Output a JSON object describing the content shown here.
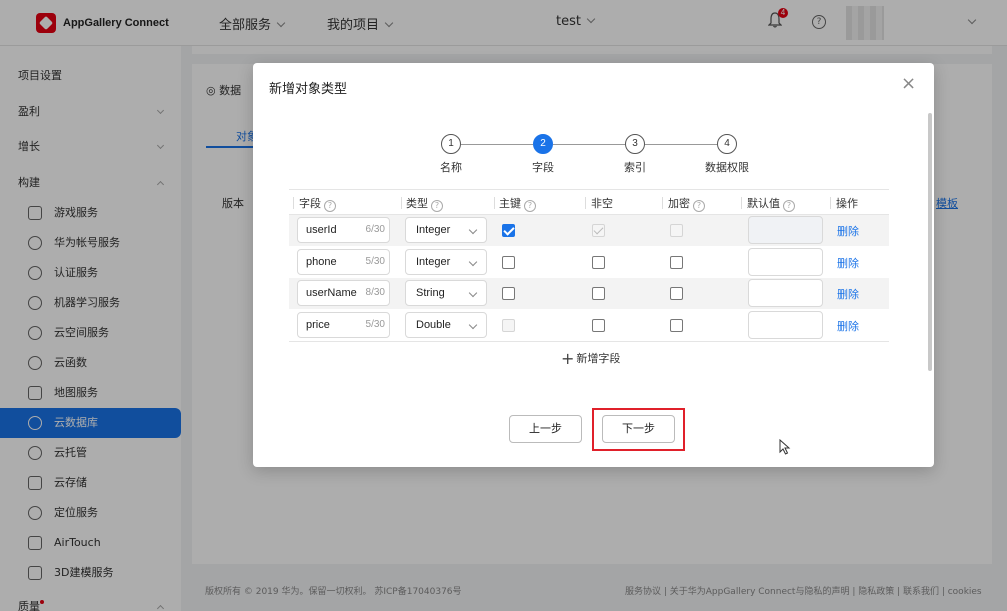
{
  "header": {
    "brand": "AppGallery Connect",
    "nav": [
      "全部服务",
      "我的项目"
    ],
    "project": "test",
    "notification_count": "4",
    "help_icon": "?"
  },
  "sidebar": {
    "items": [
      {
        "label": "项目设置"
      },
      {
        "label": "盈利"
      },
      {
        "label": "增长"
      },
      {
        "label": "构建"
      },
      {
        "label": "游戏服务"
      },
      {
        "label": "华为帐号服务"
      },
      {
        "label": "认证服务"
      },
      {
        "label": "机器学习服务"
      },
      {
        "label": "云空间服务"
      },
      {
        "label": "云函数"
      },
      {
        "label": "地图服务"
      },
      {
        "label": "云数据库"
      },
      {
        "label": "云托管"
      },
      {
        "label": "云存储"
      },
      {
        "label": "定位服务"
      },
      {
        "label": "AirTouch"
      },
      {
        "label": "3D建模服务"
      },
      {
        "label": "质量"
      }
    ]
  },
  "background": {
    "crumb": "数据",
    "tab": "对象",
    "version_label": "版本",
    "template_link": "模板"
  },
  "footer": {
    "copyright": "版权所有 © 2019 华为。保留一切权利。 苏ICP备17040376号",
    "links": "服务协议 | 关于华为AppGallery Connect与隐私的声明 | 隐私政策 | 联系我们 | cookies"
  },
  "modal": {
    "title": "新增对象类型",
    "close": "×",
    "steps": [
      {
        "num": "1",
        "label": "名称"
      },
      {
        "num": "2",
        "label": "字段"
      },
      {
        "num": "3",
        "label": "索引"
      },
      {
        "num": "4",
        "label": "数据权限"
      }
    ],
    "active_step": 2,
    "columns": [
      "字段",
      "类型",
      "主键",
      "非空",
      "加密",
      "默认值",
      "操作"
    ],
    "rows": [
      {
        "field": "userId",
        "count": "6/30",
        "type": "Integer",
        "primary_key": true,
        "not_null": true,
        "encrypted": false,
        "default": "",
        "action": "删除"
      },
      {
        "field": "phone",
        "count": "5/30",
        "type": "Integer",
        "primary_key": false,
        "not_null": false,
        "encrypted": false,
        "default": "",
        "action": "删除"
      },
      {
        "field": "userName",
        "count": "8/30",
        "type": "String",
        "primary_key": false,
        "not_null": false,
        "encrypted": false,
        "default": "",
        "action": "删除"
      },
      {
        "field": "price",
        "count": "5/30",
        "type": "Double",
        "primary_key": false,
        "not_null": false,
        "encrypted": false,
        "default": "",
        "action": "删除"
      }
    ],
    "add_field": "新增字段",
    "prev_button": "上一步",
    "next_button": "下一步"
  }
}
